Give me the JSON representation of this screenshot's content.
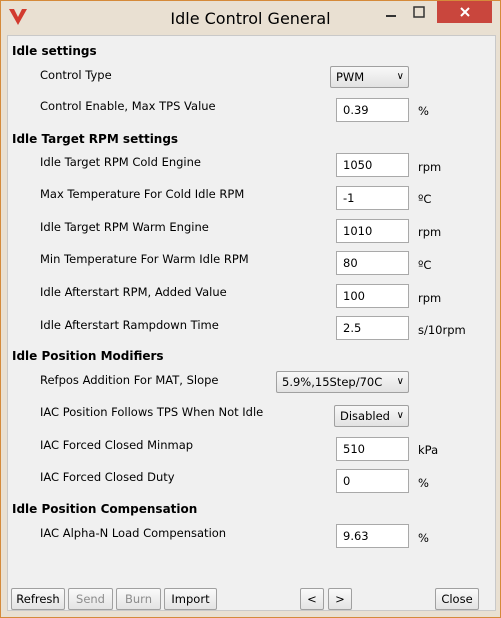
{
  "window": {
    "title": "Idle Control General",
    "accent": "#c9463d"
  },
  "sections": [
    "Idle settings",
    "Idle Target RPM settings",
    "Idle Position Modifiers",
    "Idle Position Compensation"
  ],
  "rows": {
    "control_type": {
      "label": "Control Type",
      "value": "PWM"
    },
    "control_enable": {
      "label": "Control Enable, Max TPS Value",
      "value": "0.39",
      "unit": "%"
    },
    "cold_rpm": {
      "label": "Idle Target RPM Cold Engine",
      "value": "1050",
      "unit": "rpm"
    },
    "max_temp_cold": {
      "label": "Max Temperature For Cold Idle RPM",
      "value": "-1",
      "unit": "ºC"
    },
    "warm_rpm": {
      "label": "Idle Target RPM Warm Engine",
      "value": "1010",
      "unit": "rpm"
    },
    "min_temp_warm": {
      "label": "Min Temperature For Warm Idle RPM",
      "value": "80",
      "unit": "ºC"
    },
    "afterstart_rpm": {
      "label": "Idle Afterstart RPM, Added Value",
      "value": "100",
      "unit": "rpm"
    },
    "afterstart_ramp": {
      "label": "Idle Afterstart Rampdown Time",
      "value": "2.5",
      "unit": "s/10rpm"
    },
    "refpos_mat": {
      "label": "Refpos Addition For MAT, Slope",
      "value": "5.9%,15Step/70C"
    },
    "iac_follows_tps": {
      "label": "IAC Position Follows TPS When Not Idle",
      "value": "Disabled"
    },
    "iac_forced_minmap": {
      "label": "IAC Forced Closed Minmap",
      "value": "510",
      "unit": "kPa"
    },
    "iac_forced_duty": {
      "label": "IAC Forced Closed Duty",
      "value": "0",
      "unit": "%"
    },
    "iac_alpha_n": {
      "label": "IAC Alpha-N Load Compensation",
      "value": "9.63",
      "unit": "%"
    }
  },
  "buttons": {
    "refresh": "Refresh",
    "send": "Send",
    "burn": "Burn",
    "import": "Import",
    "prev": "<",
    "next": ">",
    "close": "Close"
  }
}
